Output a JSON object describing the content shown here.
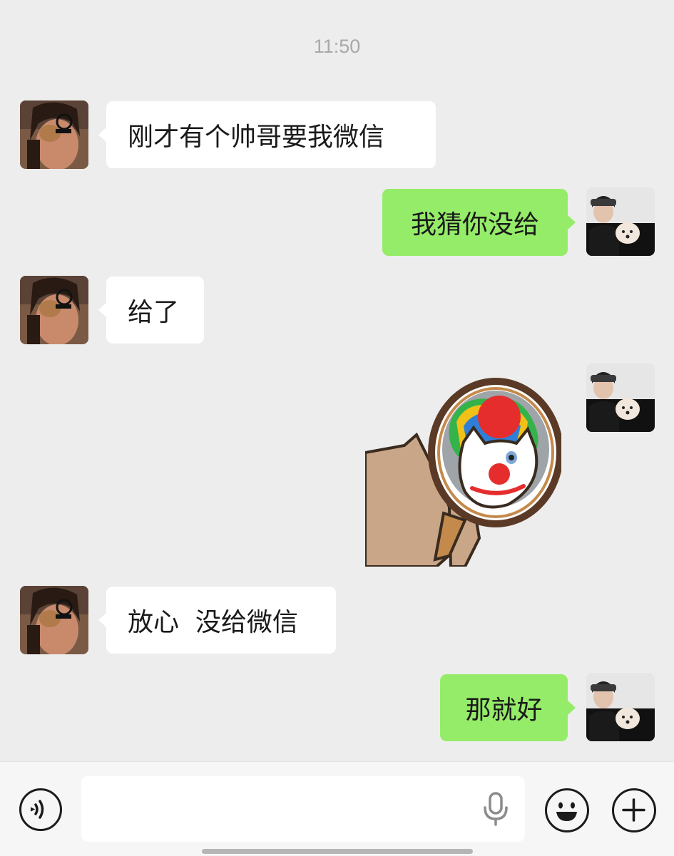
{
  "chat": {
    "timestamp": "11:50",
    "messages": [
      {
        "sender": "contact",
        "type": "text",
        "text": "刚才有个帅哥要我微信"
      },
      {
        "sender": "me",
        "type": "text",
        "text": "我猜你没给"
      },
      {
        "sender": "contact",
        "type": "text",
        "text": "给了"
      },
      {
        "sender": "me",
        "type": "sticker",
        "sticker": "clown-cat-mirror-sticker"
      },
      {
        "sender": "contact",
        "type": "text",
        "text": "放心  没给微信"
      },
      {
        "sender": "me",
        "type": "text",
        "text": "那就好"
      }
    ]
  },
  "input_bar": {
    "placeholder": "",
    "value": "",
    "icons": [
      "voice-input-icon",
      "microphone-icon",
      "emoji-icon",
      "plus-icon"
    ]
  },
  "colors": {
    "background": "#ededed",
    "outgoing_bubble": "#95ec69",
    "incoming_bubble": "#ffffff",
    "timestamp": "#a9a9a9"
  }
}
